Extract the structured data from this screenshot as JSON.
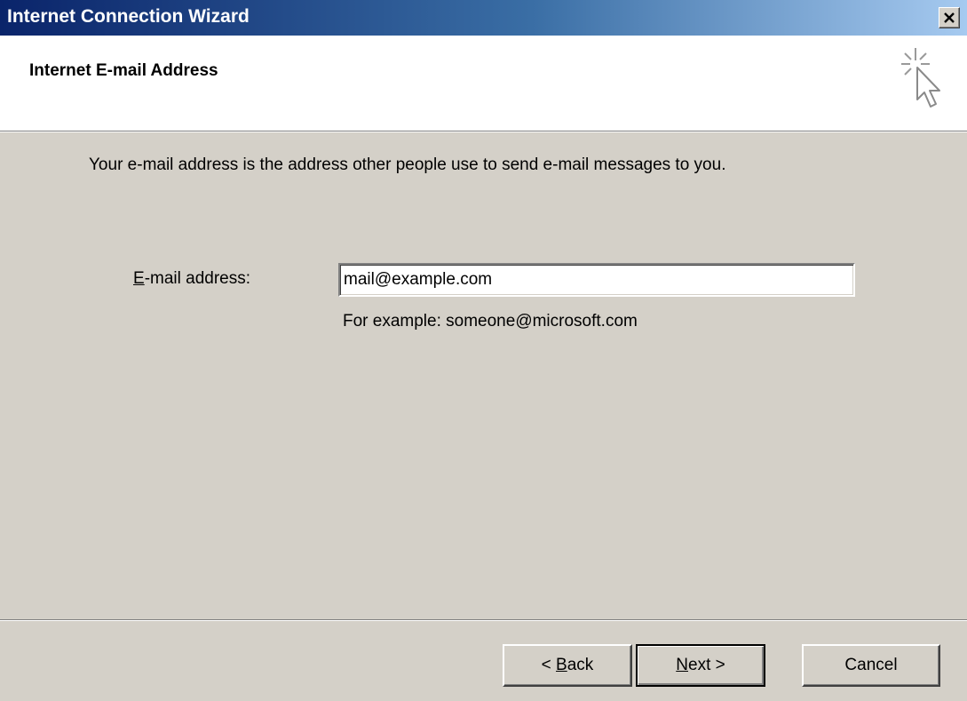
{
  "window": {
    "title": "Internet Connection Wizard",
    "close_label": "×"
  },
  "header": {
    "title": "Internet E-mail Address",
    "icon": "wizard-sparkle-cursor-icon"
  },
  "body": {
    "description": "Your e-mail address is the address other people use to send e-mail messages to you.",
    "email_label_accel": "E",
    "email_label_rest": "-mail address:",
    "email_value": "mail@example.com",
    "example_text": "For example: someone@microsoft.com"
  },
  "buttons": {
    "back_prefix": "< ",
    "back_accel": "B",
    "back_rest": "ack",
    "next_accel": "N",
    "next_rest": "ext >",
    "cancel": "Cancel"
  },
  "colors": {
    "titlebar_start": "#0a246a",
    "titlebar_end": "#a6caf0",
    "dialog_bg": "#d4d0c8",
    "header_bg": "#ffffff"
  }
}
